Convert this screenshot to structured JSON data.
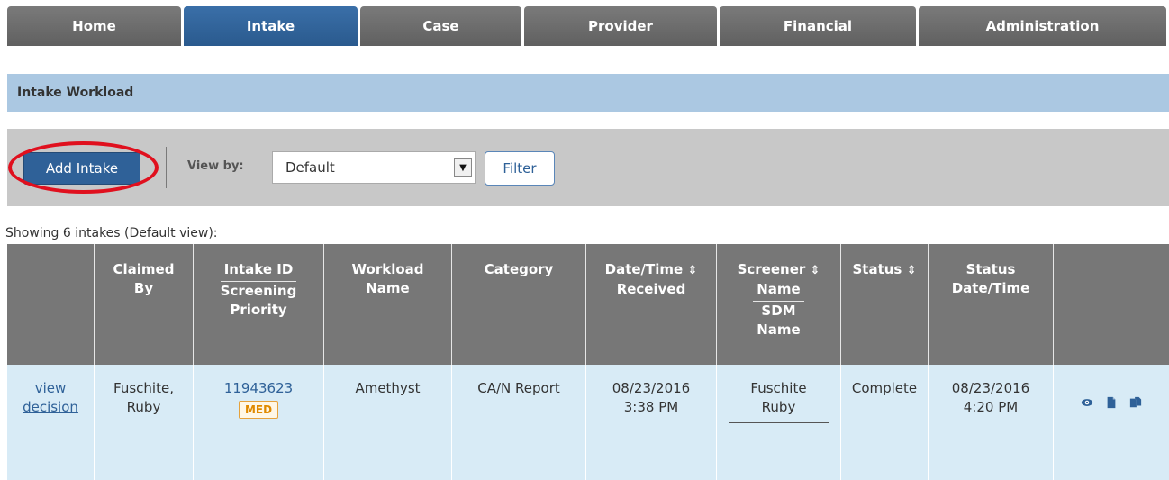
{
  "nav": {
    "tabs": [
      {
        "label": "Home",
        "active": false
      },
      {
        "label": "Intake",
        "active": true
      },
      {
        "label": "Case",
        "active": false
      },
      {
        "label": "Provider",
        "active": false
      },
      {
        "label": "Financial",
        "active": false
      },
      {
        "label": "Administration",
        "active": false
      }
    ]
  },
  "section": {
    "title": "Intake Workload"
  },
  "toolbar": {
    "add_label": "Add Intake",
    "viewby_label": "View by:",
    "select_value": "Default",
    "filter_label": "Filter"
  },
  "showing_text": "Showing 6 intakes (Default view):",
  "table": {
    "headers": {
      "claimed": [
        "Claimed",
        "By"
      ],
      "intake_id": "Intake ID",
      "screening_priority": [
        "Screening",
        "Priority"
      ],
      "workload": [
        "Workload",
        "Name"
      ],
      "category": "Category",
      "datetime": [
        "Date/Time",
        "Received"
      ],
      "screener": [
        "Screener",
        "Name"
      ],
      "sdm": [
        "SDM",
        "Name"
      ],
      "status": "Status",
      "status_dt": [
        "Status",
        "Date/Time"
      ],
      "sort_glyph": "⇕"
    },
    "row": {
      "action_link": [
        "view",
        "decision"
      ],
      "claimed": [
        "Fuschite,",
        "Ruby"
      ],
      "intake_id": "11943623",
      "priority": "MED",
      "workload": "Amethyst",
      "category": "CA/N Report",
      "received": [
        "08/23/2016",
        "3:38 PM"
      ],
      "screener": [
        "Fuschite",
        "Ruby"
      ],
      "status": "Complete",
      "status_dt": [
        "08/23/2016",
        "4:20 PM"
      ]
    }
  },
  "colors": {
    "accent": "#2f6198",
    "header_bar": "#abc8e2",
    "row_bg": "#d8ebf6",
    "highlight": "#e0101e",
    "badge": "#e08a00"
  },
  "icons": [
    "eye-icon",
    "document-icon",
    "copy-documents-icon"
  ]
}
